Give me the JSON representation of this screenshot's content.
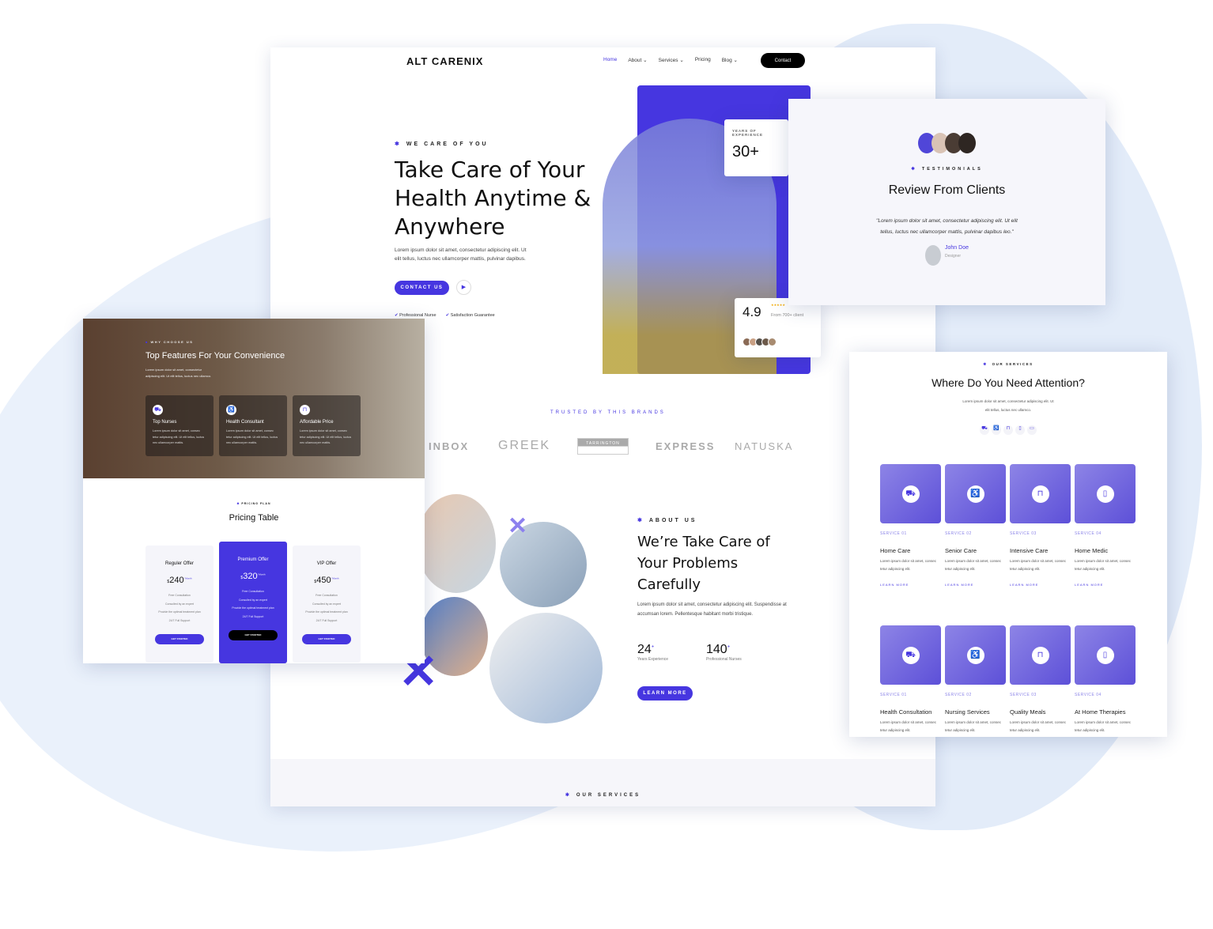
{
  "colors": {
    "accent": "#4636e0",
    "dark": "#000000"
  },
  "header": {
    "logo": "ALT CARENIX",
    "nav": [
      "Home",
      "About",
      "Services",
      "Pricing",
      "Blog"
    ],
    "contact": "Contact"
  },
  "hero": {
    "eyebrow": "WE CARE OF YOU",
    "title_lines": [
      "Take Care of Your",
      "Health Anytime &",
      "Anywhere"
    ],
    "text_lines": [
      "Lorem ipsum dolor sit amet, consectetur adipiscing elit. Ut",
      "elit tellus, luctus nec ullamcorper mattis, pulvinar dapibus."
    ],
    "cta": "CONTACT US",
    "checks": [
      "Professional Nurse",
      "Satisfaction Guarantee"
    ],
    "years_label": "YEARS OF EXPERIENCE",
    "years_value": "30+",
    "rating": "4.9",
    "rating_stars": 5,
    "rating_label": "From 700+ client"
  },
  "brands": {
    "title": "TRUSTED BY THIS BRANDS",
    "logos": [
      "INBOX",
      "GREEK",
      "TARRINGTON",
      "EXPRESS",
      "NATUSKA"
    ]
  },
  "about": {
    "eyebrow": "ABOUT US",
    "title_lines": [
      "We’re Take Care of",
      "Your Problems",
      "Carefully"
    ],
    "text": "Lorem ipsum dolor sit amet, consectetur adipiscing elit. Suspendisse at accumsan lorem. Pellentesque habitant morbi tristique.",
    "stats": [
      {
        "value": "24",
        "suffix": "+",
        "label": "Years Experience"
      },
      {
        "value": "140",
        "suffix": "+",
        "label": "Professional Nurses"
      }
    ],
    "cta": "LEARN MORE"
  },
  "footer_strip": {
    "eyebrow": "OUR SERVICES"
  },
  "testimonials": {
    "eyebrow": "TESTIMONIALS",
    "title": "Review From Clients",
    "quote_lines": [
      "\"Lorem ipsum dolor sit amet, consectetur adipiscing elit. Ut elit",
      "tellus, luctus nec ullamcorper mattis, pulvinar dapibus leo.\""
    ],
    "author": "John Doe",
    "role": "Designer"
  },
  "features": {
    "eyebrow": "WHY CHOOSE US",
    "title": "Top Features For Your Convenience",
    "text": "Lorem ipsum dolor sit amet, consectetur adipiscing elit. Ut elit tellus, luctus nec ullamco.",
    "items": [
      {
        "title": "Top Nurses",
        "text": "Lorem ipsum dolor sit amet, consec tetur adipiscing elit. Ut elit tellus, luctus nec ullamcorper mattis."
      },
      {
        "title": "Health Consultant",
        "text": "Lorem ipsum dolor sit amet, consec tetur adipiscing elit. Ut elit tellus, luctus nec ullamcorper mattis."
      },
      {
        "title": "Affordable Price",
        "text": "Lorem ipsum dolor sit amet, consec tetur adipiscing elit. Ut elit tellus, luctus nec ullamcorper mattis."
      }
    ]
  },
  "pricing": {
    "eyebrow": "PRICING PLAN",
    "title": "Pricing Table",
    "plans": [
      {
        "name": "Reguler Offer",
        "currency": "$",
        "price": "240",
        "period": "/ Month",
        "button": "GET STARTED"
      },
      {
        "name": "Premium Offer",
        "currency": "$",
        "price": "320",
        "period": "/ Month",
        "button": "GET STARTED"
      },
      {
        "name": "VIP Offer",
        "currency": "$",
        "price": "450",
        "period": "/ Month",
        "button": "GET STARTED"
      }
    ],
    "features": [
      "Free Consultation",
      "Consulted by an expert",
      "Provide the optimal treatment plan",
      "24/7 Full Support"
    ]
  },
  "services": {
    "eyebrow": "OUR SERVICES",
    "title": "Where Do You Need Attention?",
    "text_lines": [
      "Lorem ipsum dolor sit amet, consectetur adipiscing elit. Ut",
      "elit tellus, luctus nec ullamco."
    ],
    "learn_more": "LEARN MORE",
    "item_text": "Lorem ipsum dolor sit amet, consec tetur adipiscing elit.",
    "row1": [
      {
        "num": "SERVICE 01",
        "title": "Home Care"
      },
      {
        "num": "SERVICE 02",
        "title": "Senior Care"
      },
      {
        "num": "SERVICE 03",
        "title": "Intensive Care"
      },
      {
        "num": "SERVICE 04",
        "title": "Home Medic"
      }
    ],
    "row2": [
      {
        "num": "SERVICE 01",
        "title": "Health Consultation"
      },
      {
        "num": "SERVICE 02",
        "title": "Nursing Services"
      },
      {
        "num": "SERVICE 03",
        "title": "Quality Meals"
      },
      {
        "num": "SERVICE 04",
        "title": "At Home Therapies"
      }
    ]
  }
}
